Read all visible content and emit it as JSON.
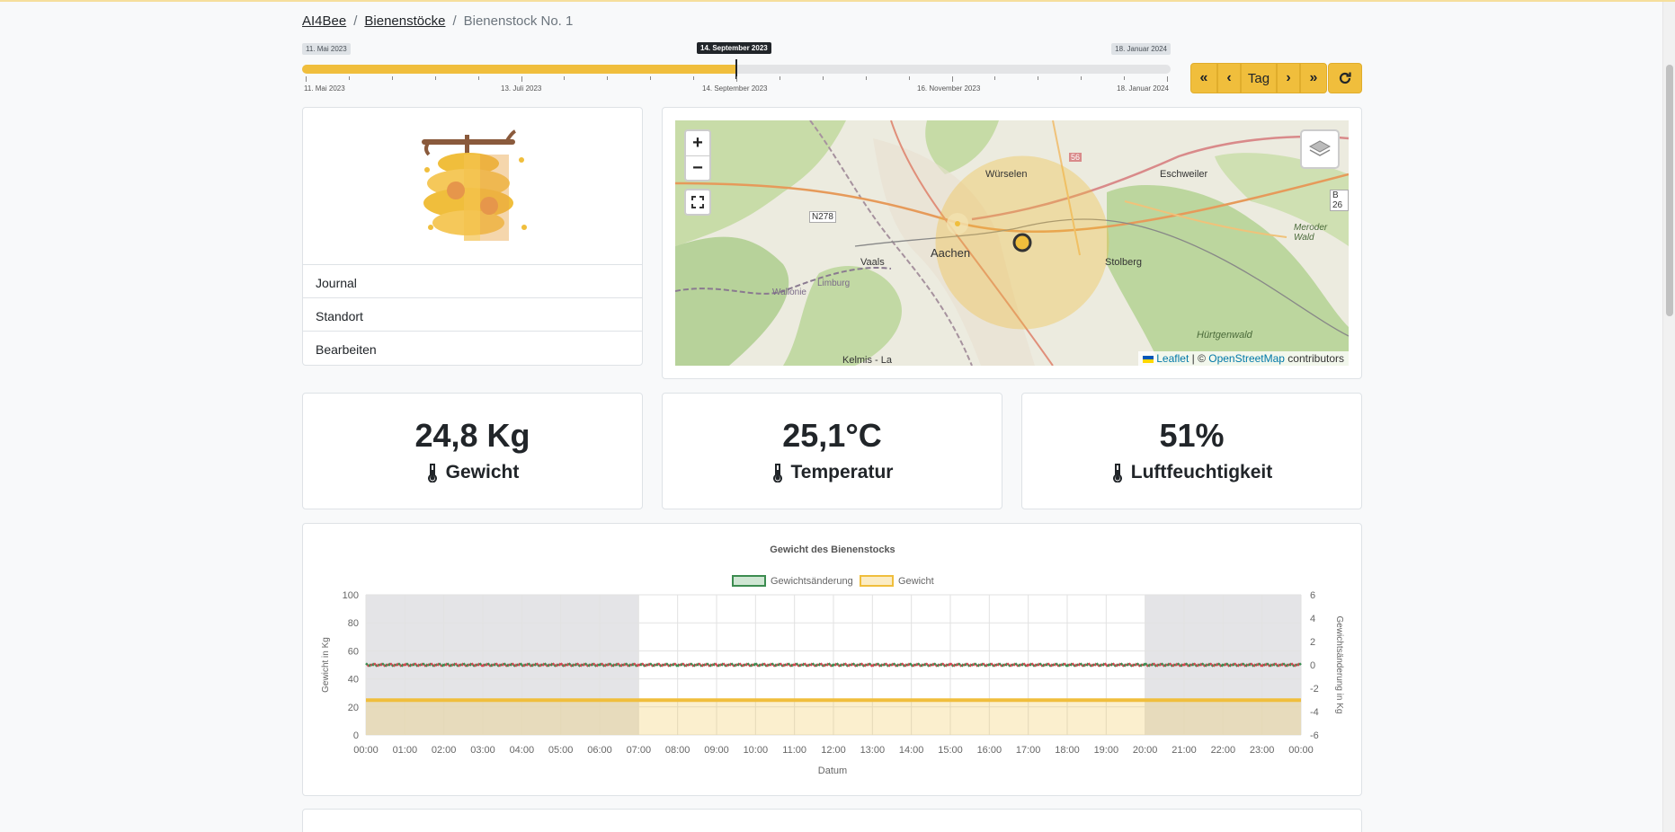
{
  "breadcrumb": {
    "home": "AI4Bee",
    "hives": "Bienenstöcke",
    "current": "Bienenstock No. 1"
  },
  "timeline": {
    "start_tag": "11. Mai 2023",
    "end_tag": "18. Januar 2024",
    "current_tag": "14. September 2023",
    "progress": 0.5,
    "tick_labels": [
      "11. Mai 2023",
      "13. Juli 2023",
      "14. September 2023",
      "16. November 2023",
      "18. Januar 2024"
    ]
  },
  "controls": {
    "first": "«",
    "prev": "‹",
    "unit": "Tag",
    "next": "›",
    "last": "»",
    "refresh": "⟳"
  },
  "hive_menu": {
    "journal": "Journal",
    "location": "Standort",
    "edit": "Bearbeiten"
  },
  "map": {
    "zoom_in": "+",
    "zoom_out": "−",
    "labels": {
      "wuerselen": "Würselen",
      "eschweiler": "Eschweiler",
      "aachen": "Aachen",
      "vaals": "Vaals",
      "stolberg": "Stolberg",
      "n278": "N278",
      "b26": "B 26",
      "kelmis": "Kelmis - La",
      "huertgenwald": "Hürtgenwald",
      "wallonie": "Wallonie",
      "limburg": "Limburg",
      "meroder": "Meroder Wald",
      "road56": "56"
    },
    "attribution": {
      "leaflet": "Leaflet",
      "sep": " | © ",
      "osm": "OpenStreetMap",
      "contrib": " contributors"
    }
  },
  "stats": {
    "weight": {
      "value": "24,8 Kg",
      "label": "Gewicht"
    },
    "temperature": {
      "value": "25,1°C",
      "label": "Temperatur"
    },
    "humidity": {
      "value": "51%",
      "label": "Luftfeuchtigkeit"
    }
  },
  "colors": {
    "accent": "#f0be3c",
    "green": "#3c8c50",
    "red": "#d24650"
  },
  "chart_data": {
    "type": "line",
    "title": "Gewicht des Bienenstocks",
    "xlabel": "Datum",
    "ylabel": "Gewicht in Kg",
    "y2label": "Gewichtsänderung in Kg",
    "ylim": [
      0,
      100
    ],
    "y2lim": [
      -6,
      6
    ],
    "yticks": [
      "100",
      "80",
      "60",
      "40",
      "20",
      "0"
    ],
    "y2ticks": [
      "6",
      "4",
      "2",
      "0",
      "-2",
      "-4",
      "-6"
    ],
    "categories": [
      "00:00",
      "01:00",
      "02:00",
      "03:00",
      "04:00",
      "05:00",
      "06:00",
      "07:00",
      "08:00",
      "09:00",
      "10:00",
      "11:00",
      "12:00",
      "13:00",
      "14:00",
      "15:00",
      "16:00",
      "17:00",
      "18:00",
      "19:00",
      "20:00",
      "21:00",
      "22:00",
      "23:00",
      "00:00"
    ],
    "series": [
      {
        "name": "Gewichtsänderung",
        "axis": "right",
        "values": [
          0,
          0,
          0,
          0,
          0,
          0,
          0,
          0,
          0,
          0,
          0,
          0,
          0,
          0,
          0,
          0,
          0,
          0,
          0,
          0,
          0,
          0,
          0,
          0,
          0
        ]
      },
      {
        "name": "Gewicht",
        "axis": "left",
        "values": [
          24.8,
          24.8,
          24.8,
          24.8,
          24.8,
          24.8,
          24.8,
          24.8,
          24.8,
          24.8,
          24.8,
          24.8,
          24.8,
          24.8,
          24.8,
          24.8,
          24.8,
          24.8,
          24.8,
          24.8,
          24.8,
          24.8,
          24.8,
          24.8,
          24.8
        ]
      }
    ],
    "night_shading": [
      [
        "00:00",
        "07:00"
      ],
      [
        "20:00",
        "00:00"
      ]
    ],
    "legend_position": "top",
    "grid": true
  }
}
